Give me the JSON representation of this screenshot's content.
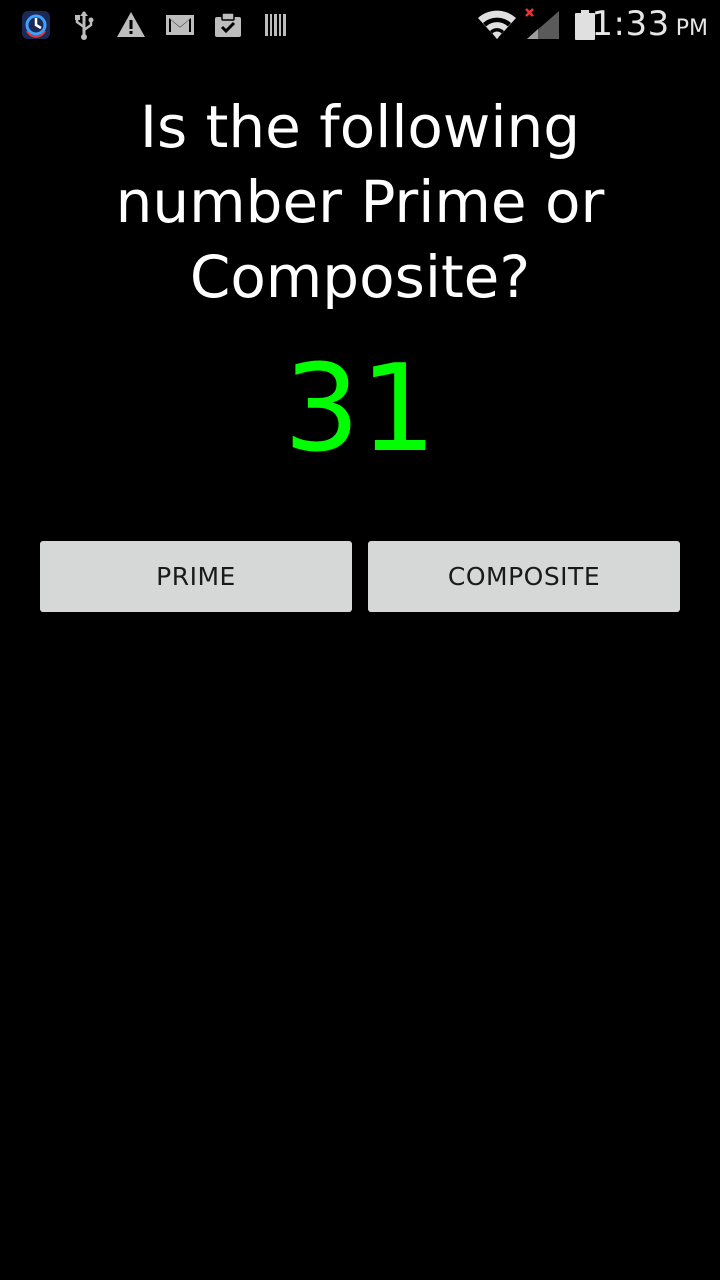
{
  "status_bar": {
    "time": "1:33",
    "ampm": "PM",
    "icons": [
      "app-icon",
      "usb-icon",
      "warning-icon",
      "gmail-icon",
      "clipboard-check-icon",
      "barcode-icon",
      "wifi-icon",
      "signal-icon",
      "battery-icon"
    ]
  },
  "quiz": {
    "question": "Is the following number Prime or Composite?",
    "number": "31",
    "number_color": "#00ff00"
  },
  "buttons": {
    "prime_label": "PRIME",
    "composite_label": "COMPOSITE"
  }
}
